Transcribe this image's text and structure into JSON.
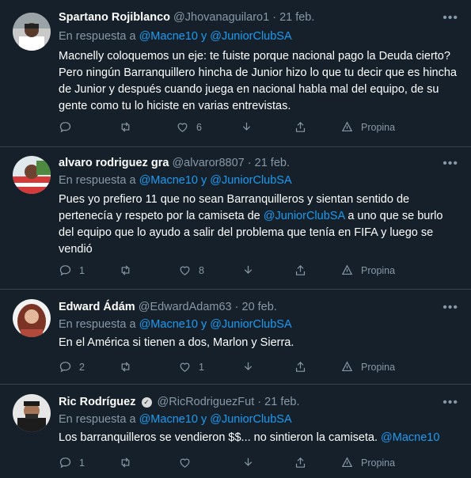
{
  "tweets": [
    {
      "name": "Spartano Rojiblanco",
      "handle": "@Jhovanaguilaro1",
      "date": "21 feb.",
      "reply_prefix": "En respuesta a",
      "reply_to_1": "@Macne10",
      "reply_and": "y",
      "reply_to_2": "@JuniorClubSA",
      "text": "Macnelly coloquemos un eje: te fuiste porque nacional pago la Deuda cierto? Pero ningún Barranquillero hincha de Junior hizo lo que tu decir que es hincha de Junior y después cuando juega en nacional habla mal del equipo, de su gente como tu lo hiciste en varias entrevistas.",
      "replies": "",
      "retweets": "",
      "likes": "6",
      "promote_label": "Propina"
    },
    {
      "name": "alvaro rodriguez gra",
      "handle": "@alvaror8807",
      "date": "21 feb.",
      "reply_prefix": "En respuesta a",
      "reply_to_1": "@Macne10",
      "reply_and": "y",
      "reply_to_2": "@JuniorClubSA",
      "text_before": "Pues yo prefiero 11 que no sean Barranquilleros y sientan sentido de pertenecía y respeto por la camiseta de ",
      "text_mention": "@JuniorClubSA",
      "text_after": " a uno que se burlo del equipo que lo ayudo a salir del problema que tenía en FIFA y luego se vendió",
      "replies": "1",
      "retweets": "",
      "likes": "8",
      "promote_label": "Propina"
    },
    {
      "name": "Edward Ádám",
      "handle": "@EdwardAdam63",
      "date": "20 feb.",
      "reply_prefix": "En respuesta a",
      "reply_to_1": "@Macne10",
      "reply_and": "y",
      "reply_to_2": "@JuniorClubSA",
      "text": "En el América si tienen a dos, Marlon y Sierra.",
      "replies": "2",
      "retweets": "",
      "likes": "1",
      "promote_label": "Propina"
    },
    {
      "name": "Ric Rodríguez",
      "handle": "@RicRodriguezFut",
      "date": "21 feb.",
      "reply_prefix": "En respuesta a",
      "reply_to_1": "@Macne10",
      "reply_and": "y",
      "reply_to_2": "@JuniorClubSA",
      "text_before": "Los barranquilleros se vendieron $$... no sintieron la camiseta. ",
      "text_mention": "@Macne10",
      "replies": "1",
      "retweets": "",
      "likes": "",
      "promote_label": "Propina"
    }
  ],
  "icons": [
    "reply-icon",
    "retweet-icon",
    "like-icon",
    "download-icon",
    "share-icon",
    "promote-icon",
    "more-icon",
    "verified-icon"
  ],
  "colors": {
    "background": "#15202b",
    "link": "#1d9bf0",
    "muted": "#8899a6",
    "divider": "#38444d"
  }
}
